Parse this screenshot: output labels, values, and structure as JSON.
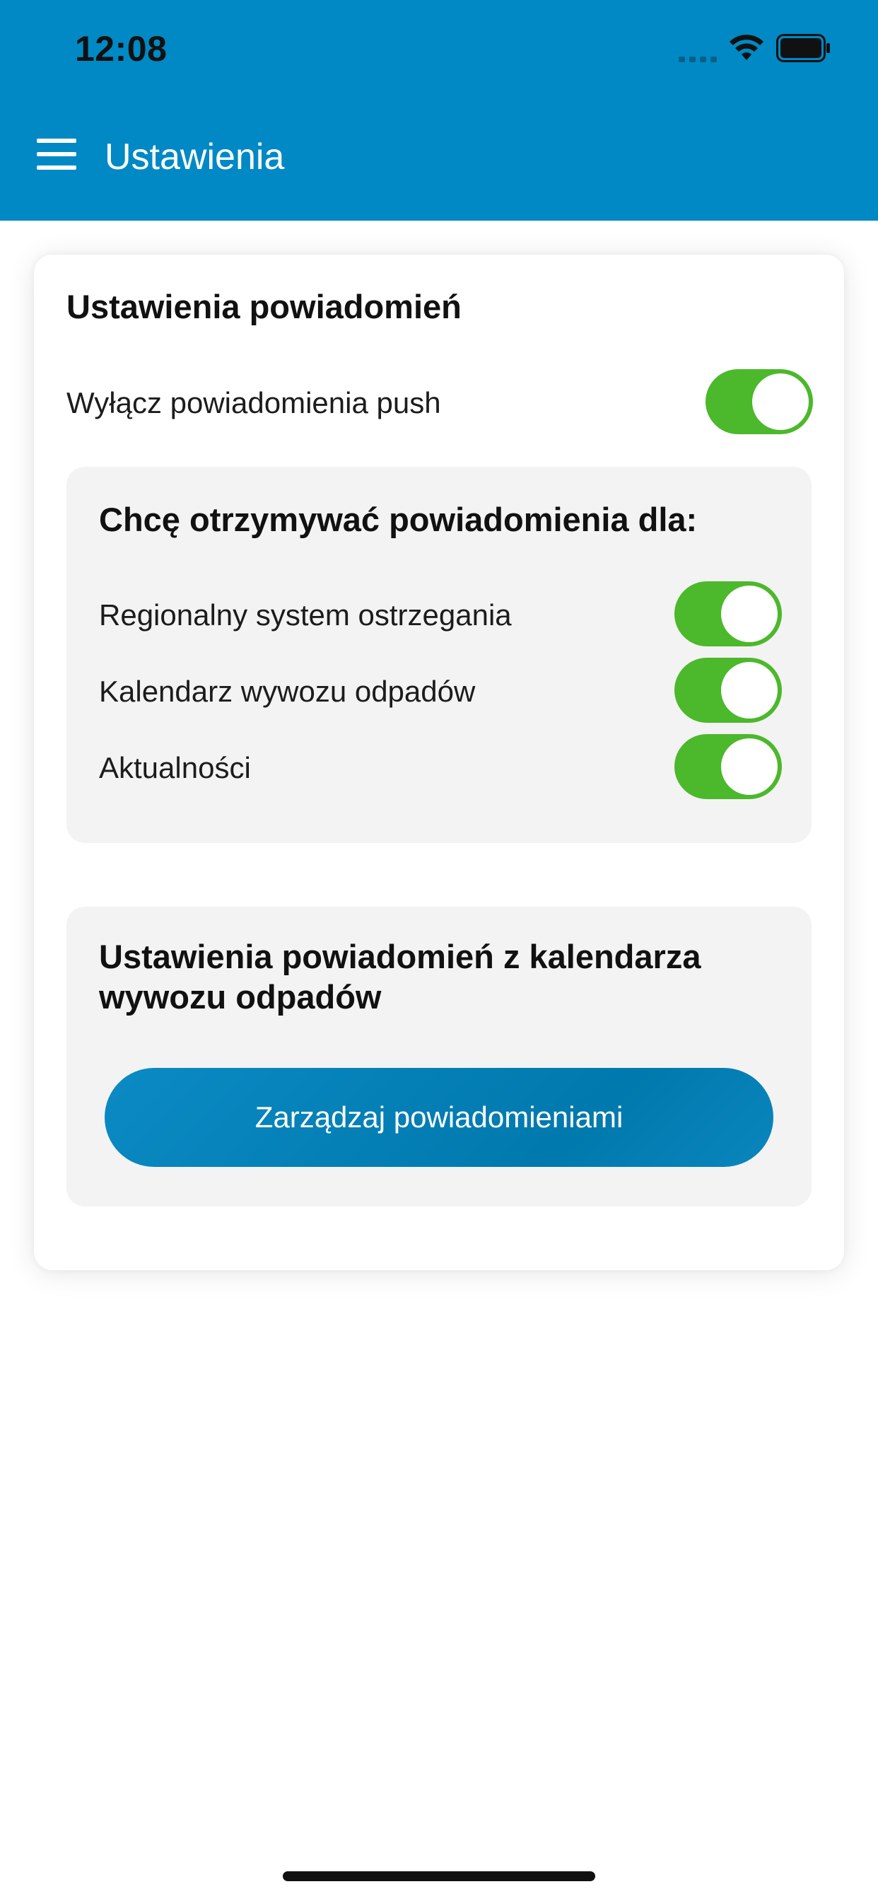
{
  "status_bar": {
    "time": "12:08"
  },
  "header": {
    "title": "Ustawienia",
    "background_color": "#0089c4"
  },
  "notifications_card": {
    "title": "Ustawienia powiadomień",
    "push_row": {
      "label": "Wyłącz powiadomienia push",
      "enabled": true
    },
    "subscriptions_panel": {
      "title": "Chcę otrzymywać powiadomienia dla:",
      "items": [
        {
          "label": "Regionalny system ostrzegania",
          "enabled": true
        },
        {
          "label": "Kalendarz wywozu odpadów",
          "enabled": true
        },
        {
          "label": "Aktualności",
          "enabled": true
        }
      ]
    },
    "waste_panel": {
      "title_line1": "Ustawienia powiadomień z kalendarza",
      "title_line2": "wywozu odpadów",
      "button_label": "Zarządzaj powiadomieniami"
    }
  },
  "colors": {
    "accent": "#0089c4",
    "toggle_on": "#4cb82b",
    "panel_bg": "#f3f3f3"
  }
}
